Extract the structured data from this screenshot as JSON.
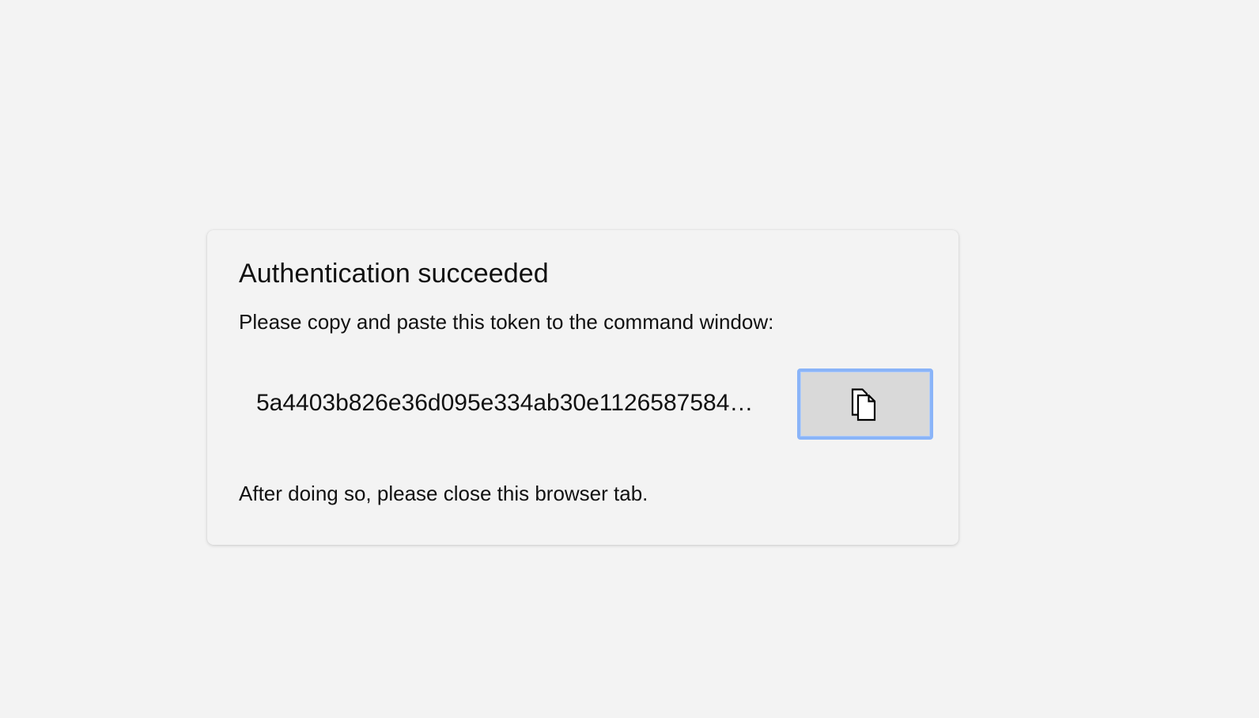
{
  "card": {
    "title": "Authentication succeeded",
    "instruction": "Please copy and paste this token to the command window:",
    "token": "5a4403b826e36d095e334ab30e1126587584…",
    "copy_button": {
      "icon": "copy-icon",
      "focus_color": "#8ab4f8",
      "background_color": "#d9d9d9"
    },
    "closing_note": "After doing so, please close this browser tab."
  },
  "colors": {
    "page_background": "#f3f3f3",
    "text": "#111111"
  }
}
